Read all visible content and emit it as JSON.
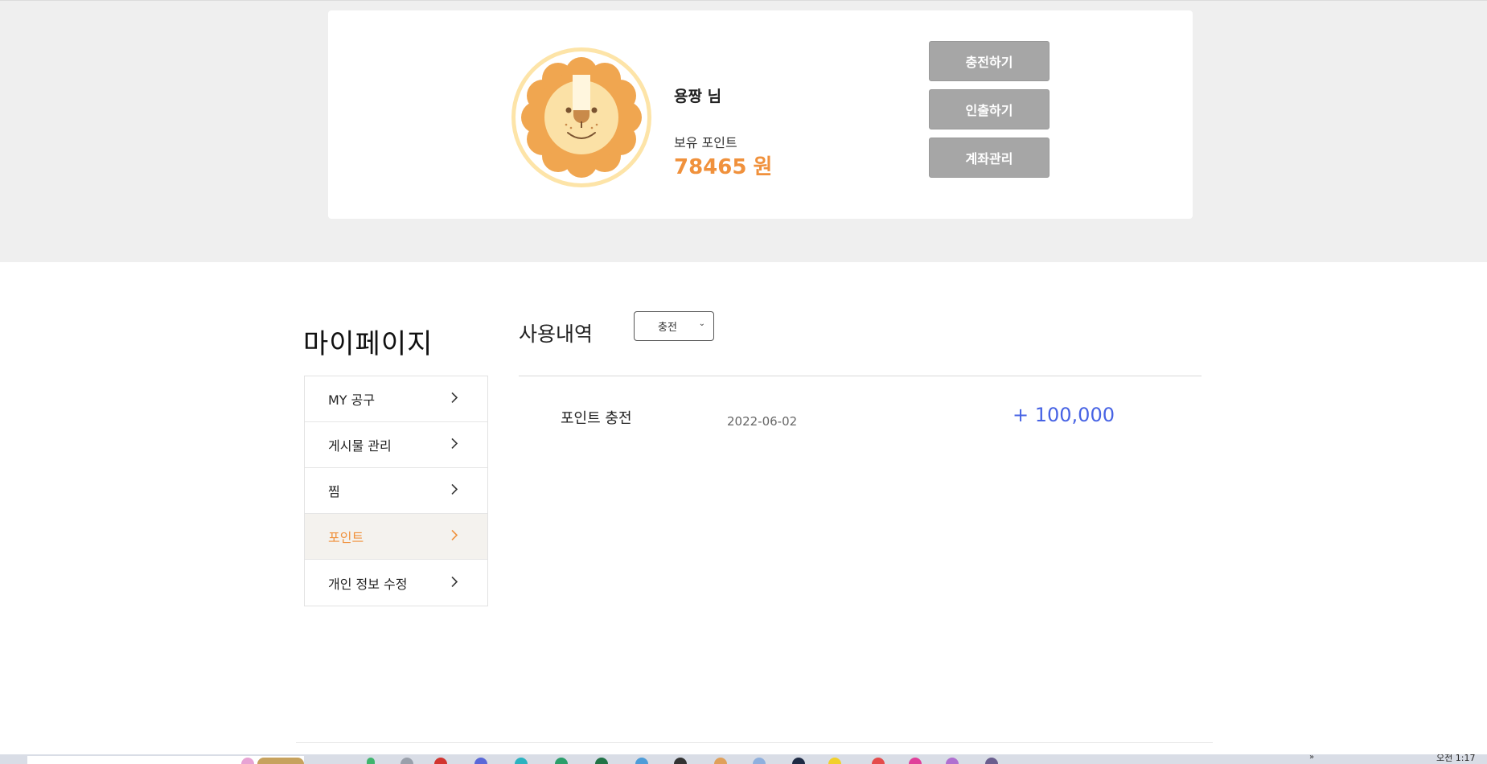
{
  "profile": {
    "name": "용짱 님",
    "points_label": "보유 포인트",
    "points_value": "78465",
    "points_unit": "원",
    "buttons": {
      "charge": "충전하기",
      "withdraw": "인출하기",
      "account": "계좌관리"
    }
  },
  "sidebar": {
    "title": "마이페이지",
    "items": [
      {
        "label": "MY 공구"
      },
      {
        "label": "게시물 관리"
      },
      {
        "label": "찜"
      },
      {
        "label": "포인트",
        "active": true
      },
      {
        "label": "개인 정보 수정"
      }
    ]
  },
  "history": {
    "title": "사용내역",
    "filter_value": "충전",
    "rows": [
      {
        "type": "포인트 충전",
        "date": "2022-06-02",
        "amount": "+ 100,000"
      }
    ]
  },
  "taskbar": {
    "overflow": "»",
    "clock": "오전 1:17"
  },
  "colors": {
    "accent": "#f0913c",
    "amount_positive": "#4763e4",
    "button_gray": "#a6a6a6",
    "top_band": "#efefef"
  }
}
